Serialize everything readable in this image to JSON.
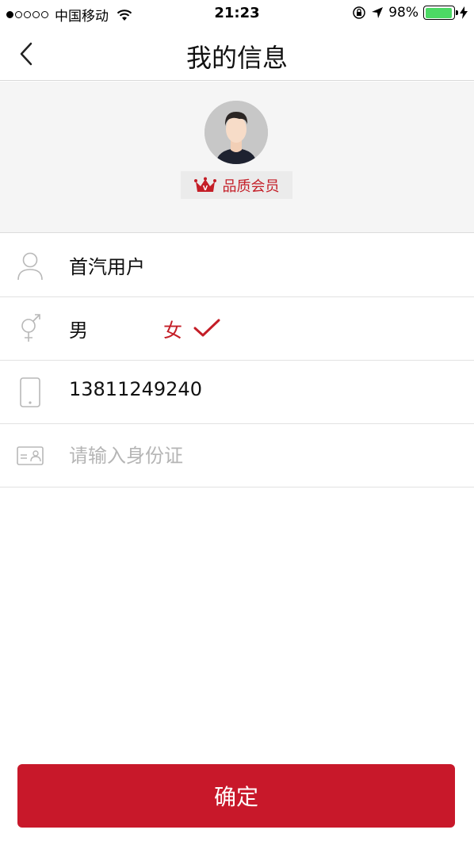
{
  "status_bar": {
    "carrier": "中国移动",
    "time": "21:23",
    "battery": "98%",
    "battery_level": 0.98
  },
  "nav": {
    "title": "我的信息",
    "back_icon": "chevron-left-icon"
  },
  "profile": {
    "avatar_icon": "user-avatar",
    "member_badge": "品质会员",
    "badge_icon": "crown-icon"
  },
  "form": {
    "username": "首汽用户",
    "gender_male": "男",
    "gender_female": "女",
    "gender_selected": "女",
    "phone": "13811249240",
    "id_placeholder": "请输入身份证",
    "id_value": ""
  },
  "actions": {
    "confirm_label": "确定"
  },
  "colors": {
    "accent": "#c41e27",
    "button": "#c8182a",
    "header_bg": "#f5f5f5"
  }
}
